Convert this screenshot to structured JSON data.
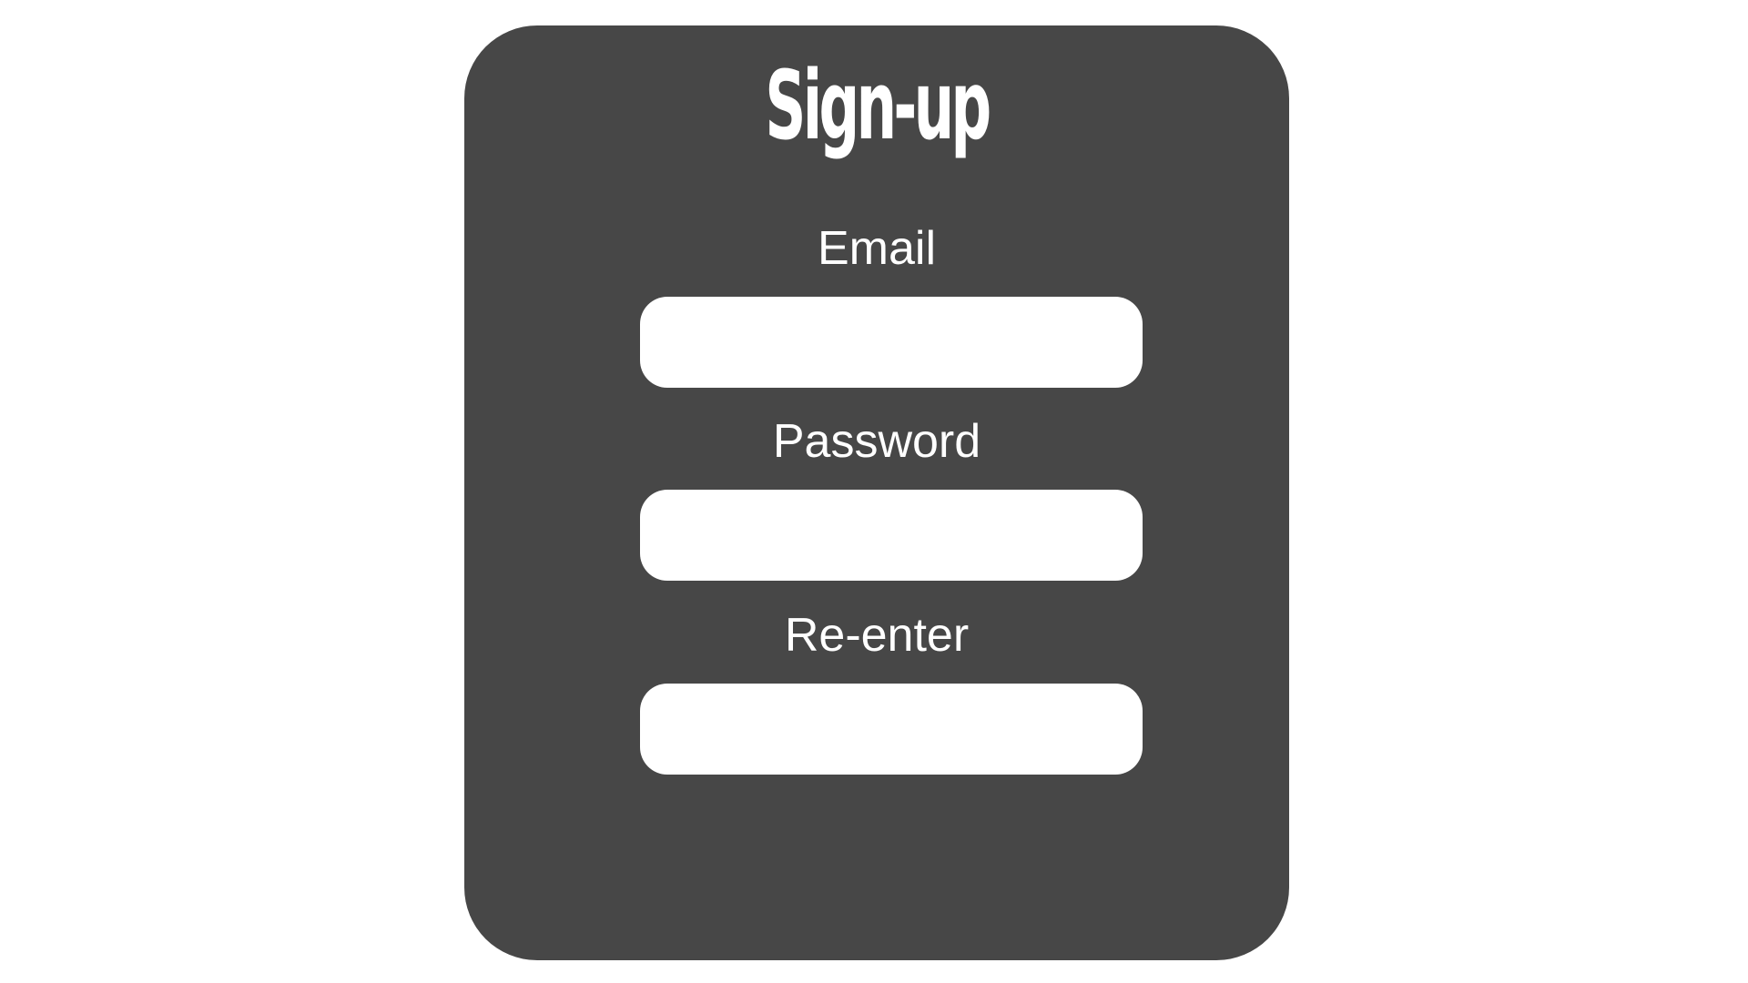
{
  "form": {
    "title": "Sign-up",
    "fields": [
      {
        "label": "Email",
        "value": "",
        "placeholder": ""
      },
      {
        "label": "Password",
        "value": "",
        "placeholder": ""
      },
      {
        "label": "Re-enter",
        "value": "",
        "placeholder": ""
      }
    ]
  },
  "colors": {
    "background": "#ffffff",
    "panel": "#474747",
    "text": "#ffffff",
    "input_background": "#ffffff"
  }
}
